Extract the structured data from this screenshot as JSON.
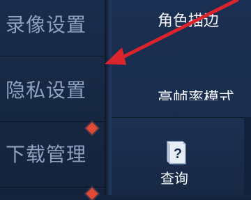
{
  "sidebar": {
    "items": [
      {
        "label": "录像设置"
      },
      {
        "label": "隐私设置"
      },
      {
        "label": "下载管理"
      }
    ]
  },
  "settings": {
    "row1_title": "角色描边",
    "row2_title": "高帧率模式"
  },
  "query": {
    "label": "查询",
    "icon": "help-book-icon"
  },
  "colors": {
    "badge": "#e24a35",
    "arrow": "#d9252b"
  }
}
